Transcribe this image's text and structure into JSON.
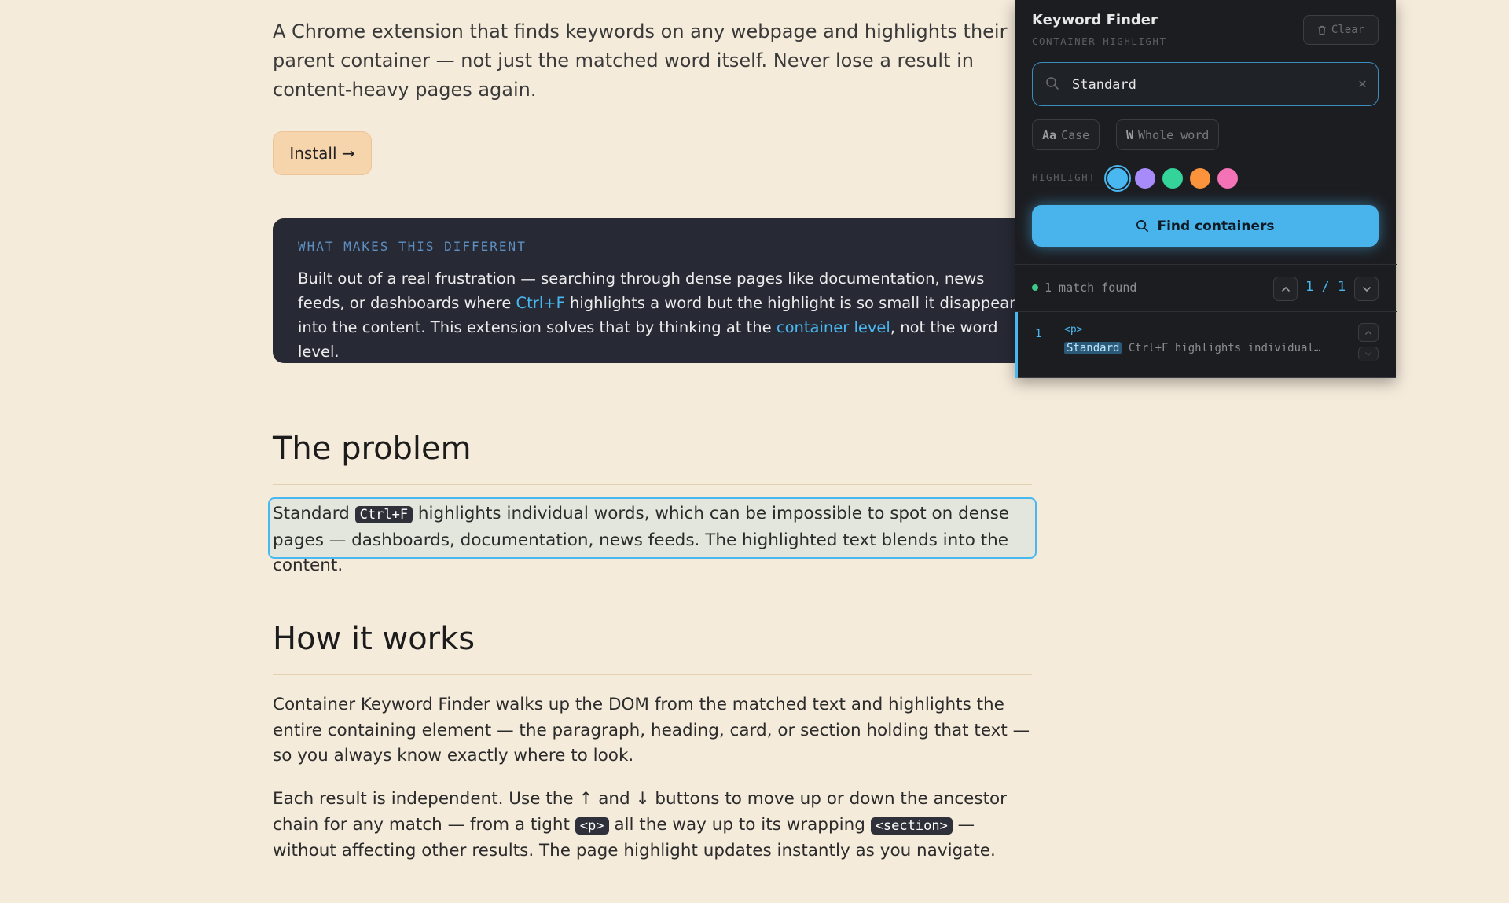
{
  "article": {
    "intro": "A Chrome extension that finds keywords on any webpage and highlights their parent container — not just the matched word itself. Never lose a result in content-heavy pages again.",
    "install_label": "Install →",
    "callout": {
      "label": "WHAT MAKES THIS DIFFERENT",
      "text_1": "Built out of a real frustration — searching through dense pages like documentation, news feeds, or dashboards where ",
      "ctrlf": "Ctrl+F",
      "text_2": " highlights a word but the highlight is so small it disappears into the content. This extension solves that by thinking at the ",
      "container_level": "container level",
      "text_3": ", not the word level."
    },
    "problem": {
      "heading": "The problem",
      "text_1": "Standard ",
      "kbd": "Ctrl+F",
      "text_2": " highlights individual words, which can be impossible to spot on dense pages — dashboards, documentation, news feeds. The highlighted text blends into the content."
    },
    "how": {
      "heading": "How it works",
      "para1": "Container Keyword Finder walks up the DOM from the matched text and highlights the entire containing element — the paragraph, heading, card, or section holding that text — so you always know exactly where to look.",
      "para2_1": "Each result is independent. Use the ↑ and ↓ buttons to move up or down the ancestor chain for any match — from a tight ",
      "code_p": "<p>",
      "para2_2": " all the way up to its wrapping ",
      "code_section": "<section>",
      "para2_3": " — without affecting other results. The page highlight updates instantly as you navigate."
    }
  },
  "panel": {
    "title": "Keyword Finder",
    "subtitle": "CONTAINER HIGHLIGHT",
    "clear_label": "Clear",
    "search_value": "Standard",
    "options": {
      "case_prefix": "Aa",
      "case_label": "Case",
      "word_prefix": "W",
      "word_label": "Whole word"
    },
    "highlight_label": "HIGHLIGHT",
    "swatches": [
      "#49b8f0",
      "#a78bfa",
      "#34d399",
      "#fb923c",
      "#f472b6"
    ],
    "selected_swatch": 0,
    "find_label": "Find containers",
    "status_text": "1 match found",
    "counter": "1 / 1",
    "result": {
      "num": "1",
      "tag": "<p>",
      "keyword": "Standard",
      "snippet": "Ctrl+F highlights individual…"
    }
  }
}
